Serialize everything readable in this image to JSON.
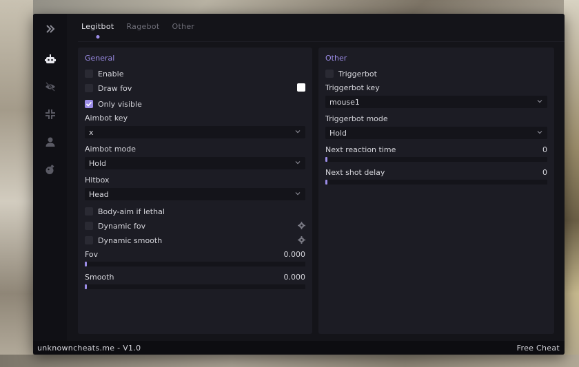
{
  "tabs": [
    {
      "label": "Legitbot",
      "active": true
    },
    {
      "label": "Ragebot",
      "active": false
    },
    {
      "label": "Other",
      "active": false
    }
  ],
  "sidebar": {
    "icons": [
      "chevrons-right-icon",
      "robot-icon",
      "eye-off-icon",
      "compress-icon",
      "user-icon",
      "grenade-icon"
    ]
  },
  "left_panel": {
    "title": "General",
    "enable": {
      "label": "Enable",
      "checked": false
    },
    "draw_fov": {
      "label": "Draw fov",
      "checked": false,
      "color": "#ffffff"
    },
    "only_visible": {
      "label": "Only visible",
      "checked": true
    },
    "aimbot_key": {
      "label": "Aimbot key",
      "value": "x"
    },
    "aimbot_mode": {
      "label": "Aimbot mode",
      "value": "Hold"
    },
    "hitbox": {
      "label": "Hitbox",
      "value": "Head"
    },
    "body_aim": {
      "label": "Body-aim if lethal",
      "checked": false
    },
    "dynamic_fov": {
      "label": "Dynamic fov",
      "checked": false
    },
    "dynamic_smooth": {
      "label": "Dynamic smooth",
      "checked": false
    },
    "fov": {
      "label": "Fov",
      "value": "0.000",
      "fraction": 0
    },
    "smooth": {
      "label": "Smooth",
      "value": "0.000",
      "fraction": 0
    }
  },
  "right_panel": {
    "title": "Other",
    "triggerbot": {
      "label": "Triggerbot",
      "checked": false
    },
    "triggerbot_key": {
      "label": "Triggerbot key",
      "value": "mouse1"
    },
    "triggerbot_mode": {
      "label": "Triggerbot mode",
      "value": "Hold"
    },
    "next_reaction_time": {
      "label": "Next reaction time",
      "value": "0",
      "fraction": 0
    },
    "next_shot_delay": {
      "label": "Next shot delay",
      "value": "0",
      "fraction": 0
    }
  },
  "footer": {
    "left": "unknowncheats.me - V1.0",
    "right": "Free Cheat"
  },
  "colors": {
    "accent": "#9b8ce6",
    "window_bg": "#141419",
    "panel_bg": "#1c1c24"
  }
}
